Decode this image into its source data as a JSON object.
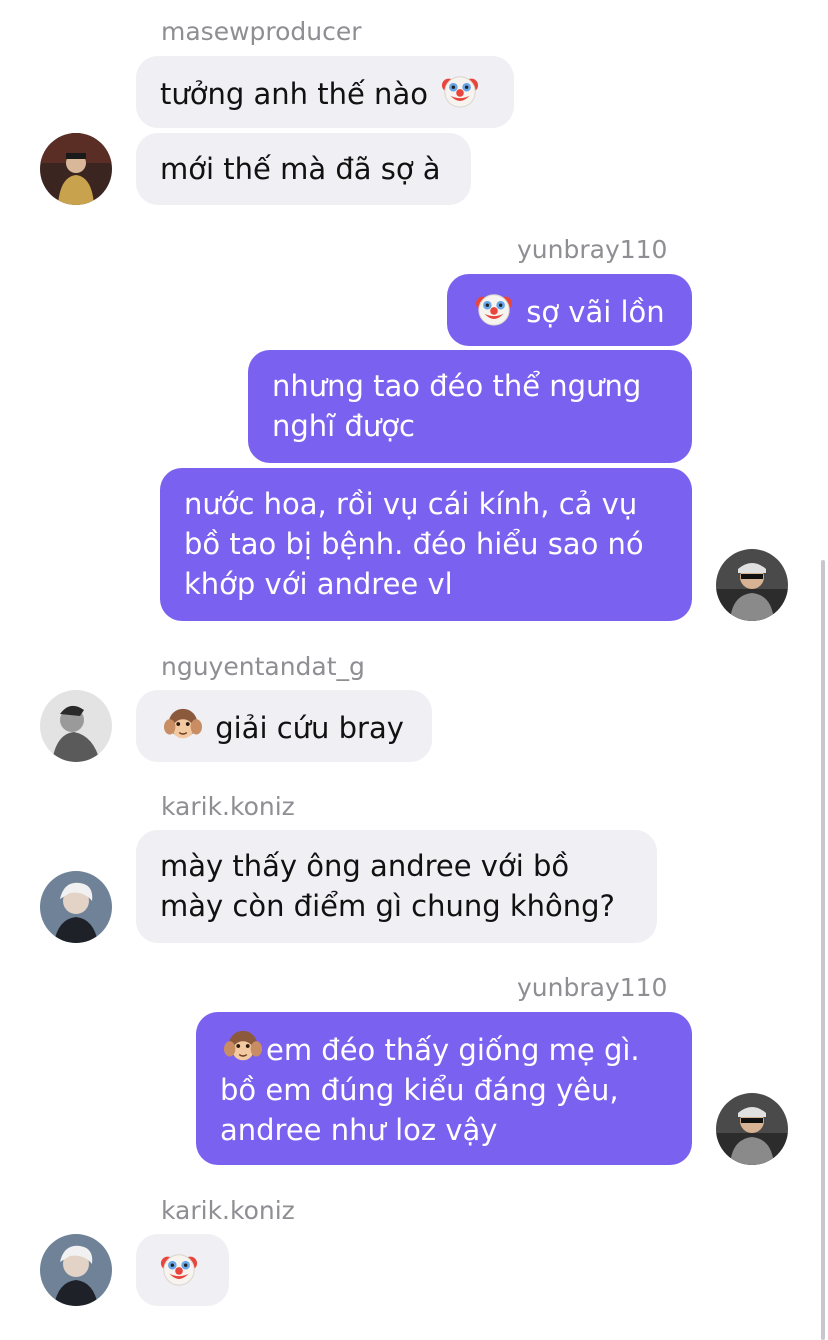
{
  "thread": {
    "g1": {
      "sender": "masewproducer",
      "m1": "tưởng anh thế nào",
      "m2": "mới thế mà đã sợ à"
    },
    "g2": {
      "sender": "yunbray110",
      "m1": "sợ vãi lồn",
      "m2_l1": "nhưng tao đéo thể ngưng",
      "m2_l2": "nghĩ được",
      "m3_l1": "nước hoa, rồi vụ cái kính, cả vụ",
      "m3_l2": "bồ tao bị bệnh. đéo hiểu sao nó",
      "m3_l3": "khớp với andree vl"
    },
    "g3": {
      "sender": "nguyentandat_g",
      "m1": "giải cứu bray"
    },
    "g4": {
      "sender": "karik.koniz",
      "m1_l1": "mày thấy ông andree với bồ",
      "m1_l2": "mày còn điểm gì chung không?"
    },
    "g5": {
      "sender": "yunbray110",
      "m1_l1": "em đéo thấy giống mẹ gì.",
      "m1_l2": "bồ em đúng kiểu đáng yêu,",
      "m1_l3": "andree như loz vậy"
    },
    "g6": {
      "sender": "karik.koniz"
    }
  },
  "icons": {
    "clown": "clown-face-emoji",
    "monkey": "hear-no-evil-monkey-emoji"
  },
  "colors": {
    "outgoing_bubble": "#7b61f0",
    "incoming_bubble": "#efeff4",
    "sender_label": "#8e8e93"
  }
}
